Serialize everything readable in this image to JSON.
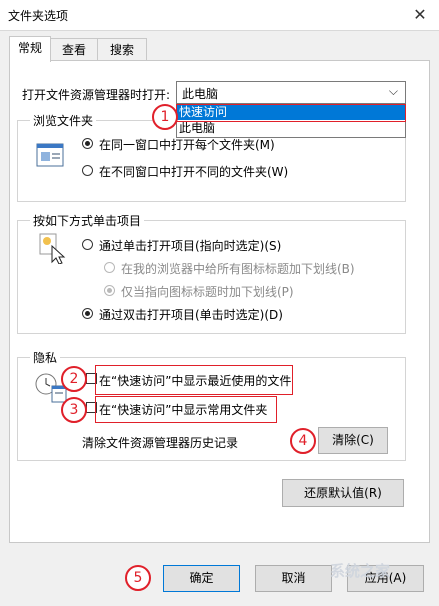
{
  "window": {
    "title": "文件夹选项",
    "close_symbol": "✕"
  },
  "tabs": [
    {
      "label": "常规",
      "active": true
    },
    {
      "label": "查看",
      "active": false
    },
    {
      "label": "搜索",
      "active": false
    }
  ],
  "open_explorer": {
    "label": "打开文件资源管理器时打开:",
    "selected": "此电脑",
    "options": [
      "快速访问",
      "此电脑"
    ],
    "highlighted_option": "快速访问"
  },
  "browse_folders": {
    "title": "浏览文件夹",
    "options": [
      {
        "label": "在同一窗口中打开每个文件夹(M)",
        "checked": true
      },
      {
        "label": "在不同窗口中打开不同的文件夹(W)",
        "checked": false
      }
    ]
  },
  "click_items": {
    "title": "按如下方式单击项目",
    "single_click": {
      "label": "通过单击打开项目(指向时选定)(S)",
      "checked": false
    },
    "underline_all": {
      "label": "在我的浏览器中给所有图标标题加下划线(B)",
      "checked": false
    },
    "underline_hover": {
      "label": "仅当指向图标标题时加下划线(P)",
      "checked": true
    },
    "double_click": {
      "label": "通过双击打开项目(单击时选定)(D)",
      "checked": true
    }
  },
  "privacy": {
    "title": "隐私",
    "recent_files": {
      "label": "在“快速访问”中显示最近使用的文件",
      "checked": false
    },
    "frequent_folders": {
      "label": "在“快速访问”中显示常用文件夹",
      "checked": false
    },
    "clear_history_label": "清除文件资源管理器历史记录",
    "clear_button": "清除(C)"
  },
  "restore_defaults_button": "还原默认值(R)",
  "footer": {
    "ok": "确定",
    "cancel": "取消",
    "apply": "应用(A)"
  },
  "annotations": [
    "1",
    "2",
    "3",
    "4",
    "5"
  ],
  "watermark": "系统之家",
  "colors": {
    "accent": "#0078d7",
    "annotation": "#e0202a"
  }
}
